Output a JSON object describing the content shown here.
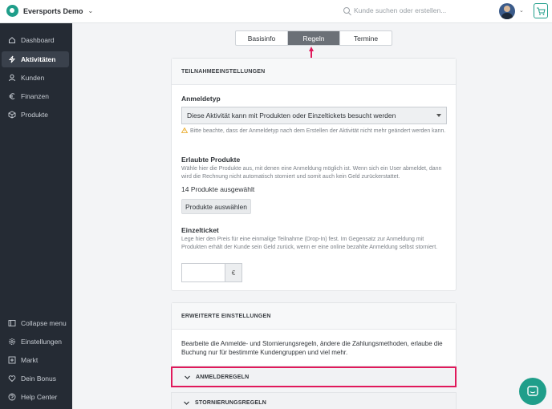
{
  "app": {
    "brand_name": "Eversports Demo",
    "search_placeholder": "Kunde suchen oder erstellen..."
  },
  "colors": {
    "accent": "#1f9e8a",
    "sidebar_bg": "#252b34",
    "highlight": "#e0195b"
  },
  "sidebar": {
    "top_items": [
      {
        "label": "Dashboard",
        "icon": "home-icon",
        "active": false
      },
      {
        "label": "Aktivitäten",
        "icon": "bolt-icon",
        "active": true
      },
      {
        "label": "Kunden",
        "icon": "user-icon",
        "active": false
      },
      {
        "label": "Finanzen",
        "icon": "euro-icon",
        "active": false
      },
      {
        "label": "Produkte",
        "icon": "box-icon",
        "active": false
      }
    ],
    "bottom_items": [
      {
        "label": "Collapse menu",
        "icon": "collapse-icon"
      },
      {
        "label": "Einstellungen",
        "icon": "gear-icon"
      },
      {
        "label": "Markt",
        "icon": "plus-square-icon"
      },
      {
        "label": "Dein Bonus",
        "icon": "heart-icon"
      },
      {
        "label": "Help Center",
        "icon": "help-circle-icon"
      }
    ]
  },
  "tabs": [
    {
      "label": "Basisinfo",
      "active": false
    },
    {
      "label": "Regeln",
      "active": true
    },
    {
      "label": "Termine",
      "active": false
    }
  ],
  "participation": {
    "header": "TEILNAHMEEINSTELLUNGEN",
    "registration_type_label": "Anmeldetyp",
    "registration_type_value": "Diese Aktivität kann mit Produkten oder Einzeltickets besucht werden",
    "registration_warning": "Bitte beachte, dass der Anmeldetyp nach dem Erstellen der Aktivität nicht mehr geändert werden kann.",
    "products_label": "Erlaubte Produkte",
    "products_help": "Wähle hier die Produkte aus, mit denen eine Anmeldung möglich ist. Wenn sich ein User abmeldet, dann wird die Rechnung nicht automatisch storniert und somit auch kein Geld zurückerstattet.",
    "products_count": "14 Produkte ausgewählt",
    "products_button": "Produkte auswählen",
    "single_ticket_label": "Einzelticket",
    "single_ticket_help": "Lege hier den Preis für eine einmalige Teilnahme (Drop-In) fest. Im Gegensatz zur Anmeldung mit Produkten erhält der Kunde sein Geld zurück, wenn er eine online bezahlte Anmeldung selbst storniert.",
    "single_ticket_value": "",
    "currency": "€"
  },
  "advanced": {
    "header": "ERWEITERTE EINSTELLUNGEN",
    "description": "Bearbeite die Anmelde- und Stornierungsregeln, ändere die Zahlungsmethoden, erlaube die Buchung nur für bestimmte Kundengruppen und viel mehr.",
    "sections": [
      {
        "label": "ANMELDEREGELN",
        "highlighted": true
      },
      {
        "label": "STORNIERUNGSREGELN",
        "highlighted": false
      }
    ]
  }
}
